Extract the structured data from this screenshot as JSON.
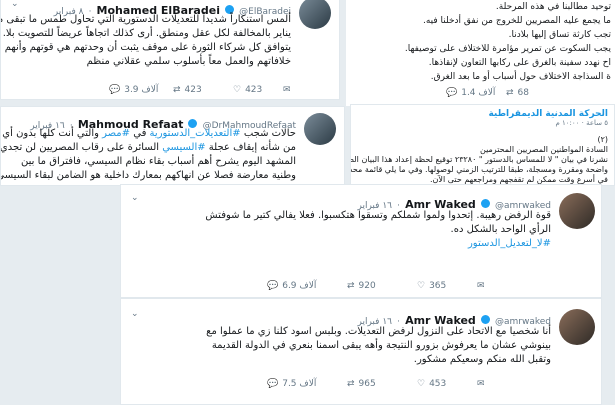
{
  "tweet_top_left": {
    "name": "Mohamed ElBaradei",
    "handle": "@ElBaradei",
    "date": "٨ فبراير",
    "lines": [
      "ألمس استنكاراً شديداً للتعديلات الدستورية التي تحاول طمس ما تبقى من",
      "يناير بالمخالفة لكل عقل ومنطق. أرى كذلك اتجاهاً عريضاً للتصويت بلا.",
      "يتوافق كل شركاء الثورة على موقف يثبت أن وحدتهم هي قوتهم وأنهم",
      "خلافاتهم والعمل معاً بأسلوب سلمي عقلاني منظم"
    ],
    "replies": "3.9 آلاف",
    "retweets": "423",
    "likes": "423"
  },
  "tweet_top_right": {
    "lines": [
      "توحيد مطالبنا في هذه المرحلة.",
      "ما يجمع عليه المصريين للخروج من نفق أدخلنا فيه.",
      "تجب كارثة تساق إليها بلادنا.",
      "يجب السكوت عن تمرير مؤامرة للاختلاف على توصيفها.",
      "اح نهدد سفينة بالغرق على ركابها التعاون لإنقاذها.",
      "ة السذاجة الاختلاف حول أسباب أو ما بعد الغرق."
    ],
    "replies": "1.4 آلاف",
    "retweets": "68"
  },
  "tweet_middle_left": {
    "name": "Mahmoud Refaat",
    "handle": "@DrMahmoudRefaat",
    "date": "١٦ فبراير",
    "hashtag_1": "#التعديلات_الدستورية",
    "hashtag_2": "#مصر",
    "hashtag_3": "#السيسي",
    "lines_a": "حالات شجب",
    "lines_b": "في",
    "lines_c": "والتي أنت كلها بدون أي",
    "line_2a": "من شأنه إيقاف عجلة",
    "line_2b": "السائرة على رقاب المصريين لن تجدي",
    "line_3": "المشهد اليوم يشرح أهم أسباب بقاء نظام السيسي، فافتراق ما بين",
    "line_4": "وطنية معارضة فصلا عن انهاكهم بمعارك داخلية هو الضامن لبقاء السيسي"
  },
  "tweet_middle_right": {
    "org": "الحركة المدنية الديمقراطية",
    "time": "٥ ساعة · ١٠:٠٠ م",
    "number": "(٢)",
    "lines": [
      "السادة المواطنين المصريين المحترمين",
      "نشرنا في بيان \" لا للمساس بالدستور \" ٢٣٢٨٠ توقيع لحظة إعداد هذا البيان الصحفي،",
      "واضحة ومقررة ومسجلة، طبقا للترتيب الزمني لوصولها. وفي ما يلي قائمة محدثة بنحو",
      "في أسرع وقت ممكن لم تقفجهم ومراجعهم حتى الآن."
    ]
  },
  "tweet_waked_1": {
    "name": "Amr Waked",
    "handle": "@amrwaked",
    "date": "١٦ فبراير",
    "line_1": "قوة الرفض رهيبة. إتحدوا ولموا شملكم وتسقوا هتكسبوا. فعلا يفالي كتير ما شوفتش",
    "line_2": "الرأي الواحد بالشكل ده.",
    "hashtag": "#لا_لتعديل_الدستور",
    "replies": "6.9 آلاف",
    "retweets": "920",
    "likes": "365"
  },
  "tweet_waked_2": {
    "name": "Amr Waked",
    "handle": "@amrwaked",
    "date": "١٦ فبراير",
    "lines": [
      "أنا شخصيا مع الاتحاد على النزول لرفض التعديلات. وبلبس اسود كلنا زي ما عملوا مع",
      "بينوشي عشان ما يعرفوش بزورو النتيجة وأهه يبقى اسمنا بنعري في الدولة القديمة",
      "وتقبل الله منكم وسعيكم مشكور."
    ],
    "replies": "7.5 آلاف",
    "retweets": "965",
    "likes": "453"
  }
}
